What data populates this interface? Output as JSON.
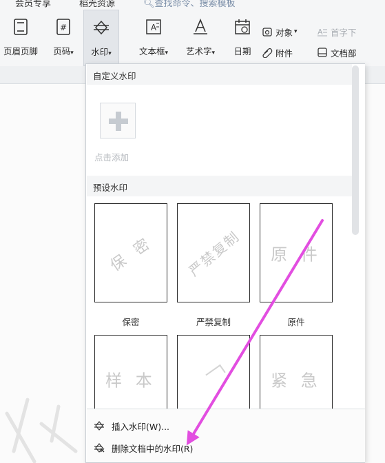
{
  "topbar": {
    "tab_member": "会员专享",
    "tab_resources": "稻壳资源",
    "search_placeholder": "查找命令、搜索模板"
  },
  "toolbar": {
    "header_footer": "页眉页脚",
    "page_number": "页码",
    "watermark": "水印",
    "textbox": "文本框",
    "wordart": "艺术字",
    "date": "日期",
    "object": "对象",
    "attachment": "附件",
    "drop_cap": "首字下",
    "doc_parts": "文档部"
  },
  "dropdown": {
    "custom_title": "自定义水印",
    "add_label": "点击添加",
    "preset_title": "预设水印",
    "presets": [
      {
        "name": "保密",
        "text": "保 密"
      },
      {
        "name": "严禁复制",
        "text": "严禁复制"
      },
      {
        "name": "原件",
        "text": "原 件"
      }
    ],
    "presets_row2": [
      {
        "text": "样 本"
      },
      {
        "text": "紧 急"
      }
    ],
    "menu": {
      "insert_label": "插入水印(W)...",
      "remove_label": "删除文档中的水印(R)"
    }
  },
  "colors": {
    "arrow": "#e24ee0",
    "ribbon": "#f5f6f7",
    "watermark_text": "#c9c9c9"
  }
}
